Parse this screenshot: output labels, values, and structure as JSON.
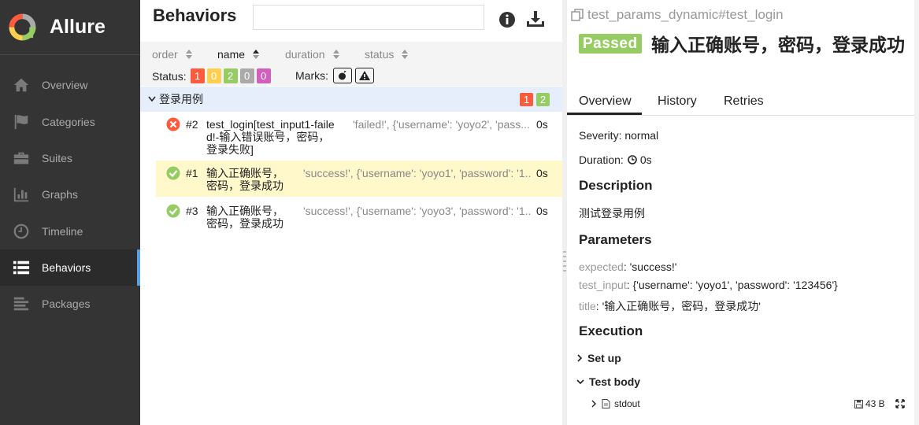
{
  "app": {
    "name": "Allure"
  },
  "sidebar": {
    "items": [
      {
        "label": "Overview",
        "icon": "home-icon",
        "active": false
      },
      {
        "label": "Categories",
        "icon": "flag-icon",
        "active": false
      },
      {
        "label": "Suites",
        "icon": "briefcase-icon",
        "active": false
      },
      {
        "label": "Graphs",
        "icon": "bar-chart-icon",
        "active": false
      },
      {
        "label": "Timeline",
        "icon": "clock-icon",
        "active": false
      },
      {
        "label": "Behaviors",
        "icon": "list-icon",
        "active": true
      },
      {
        "label": "Packages",
        "icon": "align-left-icon",
        "active": false
      }
    ]
  },
  "behaviors": {
    "title": "Behaviors",
    "search": {
      "value": "",
      "placeholder": ""
    },
    "sort": {
      "order": "order",
      "name": "name",
      "duration": "duration",
      "status": "status"
    },
    "status_label": "Status:",
    "status_counts": [
      {
        "value": "1",
        "color": "#fd5a3e"
      },
      {
        "value": "0",
        "color": "#ffd050"
      },
      {
        "value": "2",
        "color": "#97cc64"
      },
      {
        "value": "0",
        "color": "#aaaaaa"
      },
      {
        "value": "0",
        "color": "#d35ebe"
      }
    ],
    "marks_label": "Marks:",
    "group": {
      "name": "登录用例",
      "failed": "1",
      "passed": "2"
    },
    "tests": [
      {
        "status": "failed",
        "num": "#2",
        "name": "test_login[test_input1-failed!-输入错误账号，密码，登录失败]",
        "params": "'failed!', {'username': 'yoyo2', 'pass...",
        "duration": "0s"
      },
      {
        "status": "passed",
        "num": "#1",
        "name": "输入正确账号，密码，登录成功",
        "params": "'success!', {'username': 'yoyo1', 'password': '1...",
        "duration": "0s"
      },
      {
        "status": "passed",
        "num": "#3",
        "name": "输入正确账号，密码，登录成功",
        "params": "'success!', {'username': 'yoyo3', 'password': '1...",
        "duration": "0s"
      }
    ]
  },
  "detail": {
    "breadcrumb": "test_params_dynamic#test_login",
    "status_badge": "Passed",
    "title": "输入正确账号，密码，登录成功",
    "tabs": [
      "Overview",
      "History",
      "Retries"
    ],
    "severity": "Severity: normal",
    "duration_label": "Duration:",
    "duration_value": "0s",
    "description_title": "Description",
    "description_text": "测试登录用例",
    "parameters_title": "Parameters",
    "parameters": [
      {
        "key": "expected",
        "value": "'success!'"
      },
      {
        "key": "test_input",
        "value": "{'username': 'yoyo1', 'password': '123456'}"
      },
      {
        "key": "title",
        "value": "'输入正确账号，密码，登录成功'"
      }
    ],
    "execution_title": "Execution",
    "setup_label": "Set up",
    "body_label": "Test body",
    "attachment": {
      "name": "stdout",
      "size": "43 B"
    }
  }
}
